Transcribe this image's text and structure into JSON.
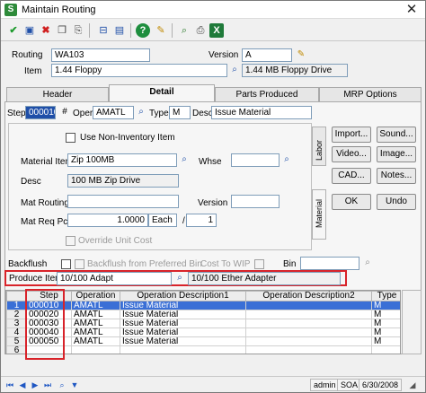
{
  "window": {
    "title": "Maintain Routing",
    "app_icon": "S",
    "close": "✕"
  },
  "toolbar": {
    "icons": [
      "check-icon",
      "save-icon",
      "delete-icon",
      "copy-icon",
      "paste-icon",
      "help-icon",
      "memo-icon",
      "lock-icon",
      "history-icon",
      "print-icon",
      "preview-icon",
      "excel-icon"
    ]
  },
  "header": {
    "routing_label": "Routing",
    "routing_value": "WA103",
    "version_label": "Version",
    "version_value": "A",
    "item_label": "Item",
    "item_value": "1.44 Floppy",
    "item_desc": "1.44 MB Floppy Drive"
  },
  "tabs": [
    "Header",
    "Detail",
    "Parts Produced",
    "MRP Options"
  ],
  "detail": {
    "step_label": "Step",
    "step_value": "000010",
    "step_spin": "#",
    "oper_label": "Oper",
    "oper_value": "AMATL",
    "type_label": "Type",
    "type_value": "M",
    "desc_label": "Desc",
    "desc_value": "Issue Material",
    "non_inventory_label": "Use Non-Inventory Item",
    "material_item_label": "Material Item",
    "material_item_value": "Zip 100MB",
    "whse_label": "Whse",
    "whse_value": "",
    "desc2_label": "Desc",
    "desc2_value": "100 MB Zip Drive",
    "mat_routing_label": "Mat Routing",
    "mat_routing_value": "",
    "version_label": "Version",
    "version_value": "",
    "mat_req_label": "Mat Req Pc",
    "mat_req_value": "1.0000",
    "mat_req_unit": "Each",
    "slash": "/",
    "mat_req_per": "1",
    "override_label": "Override Unit Cost",
    "backflush_label": "Backflush",
    "backflush_pref_label": "Backflush from Preferred Bin",
    "cost_wip_label": "Cost To WIP",
    "bin_label": "Bin",
    "bin_value": "",
    "produce_item_label": "Produce Item",
    "produce_item_value": "10/100 Adapt",
    "produce_item_desc": "10/100 Ether Adapter"
  },
  "side_tabs": [
    "Labor",
    "Material"
  ],
  "buttons": {
    "import": "Import...",
    "sound": "Sound...",
    "video": "Video...",
    "image": "Image...",
    "cad": "CAD...",
    "notes": "Notes...",
    "ok": "OK",
    "undo": "Undo"
  },
  "grid": {
    "columns": [
      "Step",
      "Operation",
      "Operation Description1",
      "Operation Description2",
      "Type"
    ],
    "rows": [
      {
        "num": "1",
        "step": "000010",
        "operation": "AMATL",
        "desc1": "Issue Material",
        "desc2": "",
        "type": "M"
      },
      {
        "num": "2",
        "step": "000020",
        "operation": "AMATL",
        "desc1": "Issue Material",
        "desc2": "",
        "type": "M"
      },
      {
        "num": "3",
        "step": "000030",
        "operation": "AMATL",
        "desc1": "Issue Material",
        "desc2": "",
        "type": "M"
      },
      {
        "num": "4",
        "step": "000040",
        "operation": "AMATL",
        "desc1": "Issue Material",
        "desc2": "",
        "type": "M"
      },
      {
        "num": "5",
        "step": "000050",
        "operation": "AMATL",
        "desc1": "Issue Material",
        "desc2": "",
        "type": "M"
      },
      {
        "num": "6",
        "step": "",
        "operation": "",
        "desc1": "",
        "desc2": "",
        "type": ""
      }
    ]
  },
  "status": {
    "user": "admin",
    "company": "SOA",
    "date": "6/30/2008"
  },
  "colors": {
    "highlight": "#d8232a",
    "selection": "#3a6fd6"
  }
}
